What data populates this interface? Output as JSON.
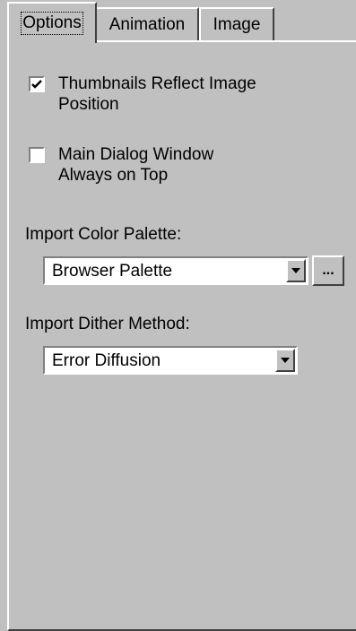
{
  "tabs": [
    {
      "label": "Options",
      "active": true
    },
    {
      "label": "Animation",
      "active": false
    },
    {
      "label": "Image",
      "active": false
    }
  ],
  "options": {
    "thumbnails_reflect": {
      "line1": "Thumbnails Reflect Image",
      "line2": "Position",
      "checked": true
    },
    "always_on_top": {
      "line1": "Main Dialog Window",
      "line2": "Always on Top",
      "checked": false
    },
    "import_color_palette": {
      "label": "Import Color Palette:",
      "value": "Browser Palette",
      "browse_label": "..."
    },
    "import_dither_method": {
      "label": "Import Dither Method:",
      "value": "Error Diffusion"
    }
  },
  "icons": {
    "check": "checkmark-icon",
    "dropdown": "chevron-down-icon"
  }
}
